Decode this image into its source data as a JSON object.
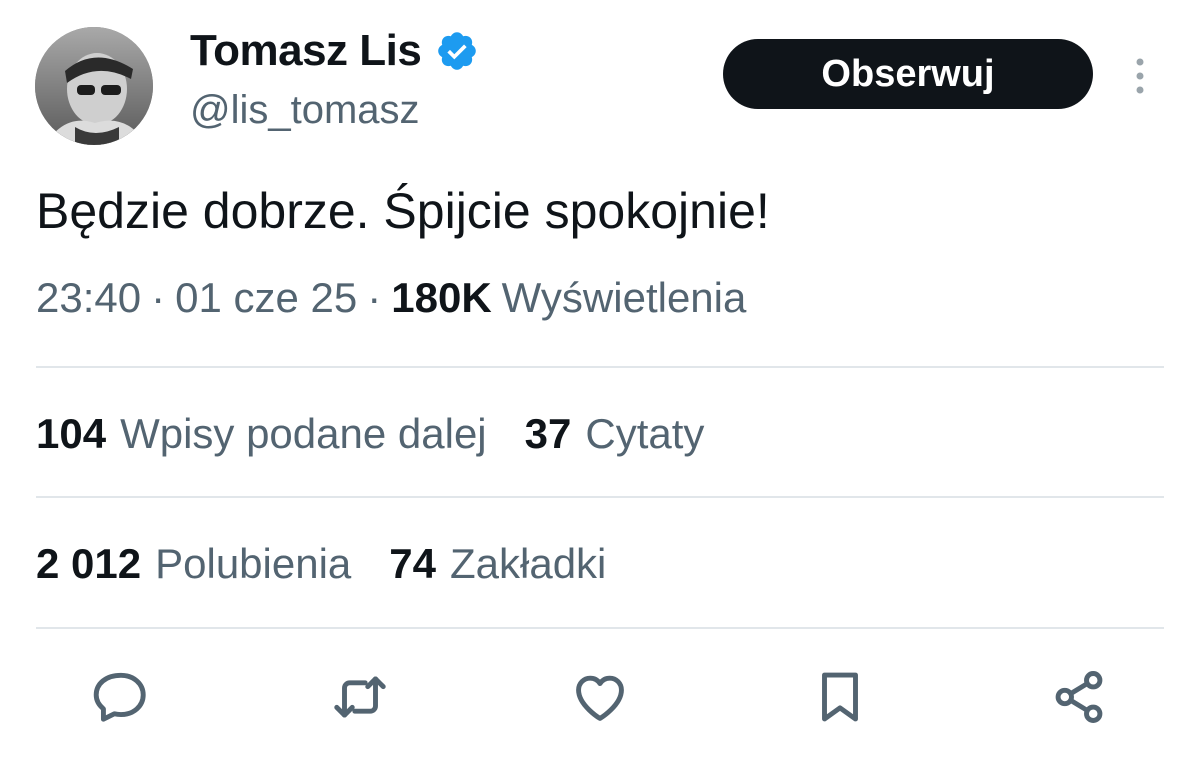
{
  "author": {
    "display_name": "Tomasz Lis",
    "handle": "@lis_tomasz",
    "verified_color": "#1d9bf0"
  },
  "follow_button": {
    "label": "Obserwuj"
  },
  "tweet": {
    "text": "Będzie dobrze. Śpijcie spokojnie!",
    "time": "23:40",
    "date": "01 cze 25",
    "separator": "·",
    "views_count": "180K",
    "views_label": "Wyświetlenia"
  },
  "stats": {
    "reposts": {
      "count": "104",
      "label": "Wpisy podane dalej"
    },
    "quotes": {
      "count": "37",
      "label": "Cytaty"
    },
    "likes": {
      "count": "2 012",
      "label": "Polubienia"
    },
    "bookmarks": {
      "count": "74",
      "label": "Zakładki"
    }
  },
  "actions": [
    "reply-icon",
    "retweet-icon",
    "like-icon",
    "bookmark-icon",
    "share-icon"
  ],
  "colors": {
    "text_primary": "#0f1419",
    "text_secondary": "#536471",
    "divider": "#e1e6ea",
    "button_bg": "#0f1419"
  }
}
